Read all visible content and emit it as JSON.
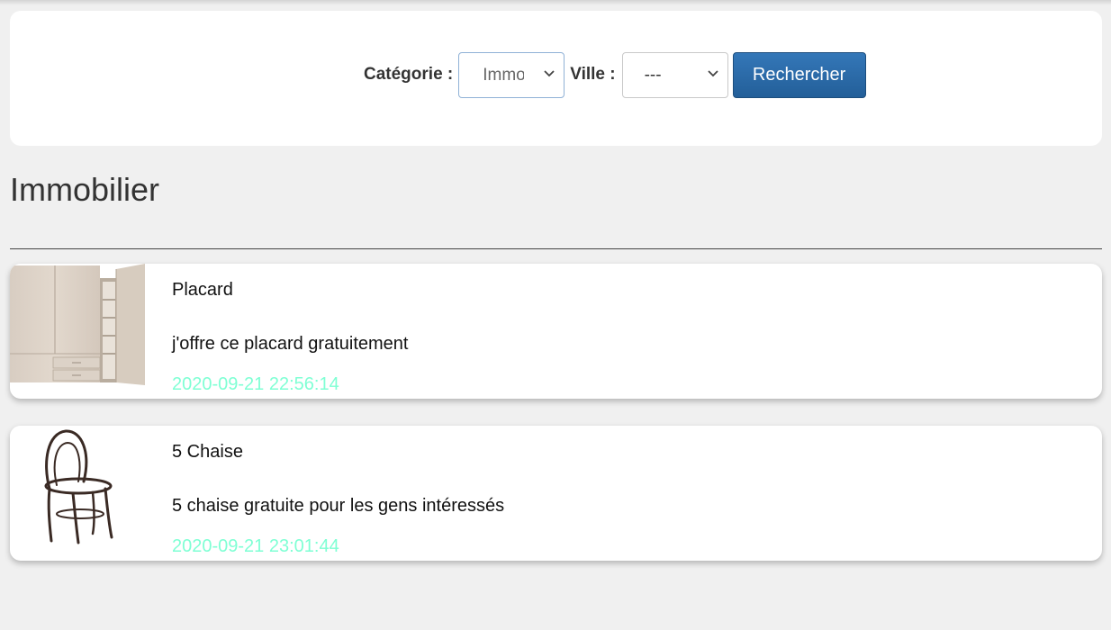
{
  "search": {
    "category_label": "Catégorie :",
    "category_value": "Immobilier",
    "city_label": "Ville :",
    "city_value": "---",
    "button_label": "Rechercher"
  },
  "page": {
    "title": "Immobilier"
  },
  "listings": [
    {
      "title": "Placard",
      "description": "j'offre ce placard gratuitement",
      "date": "2020-09-21 22:56:14",
      "image": "wardrobe"
    },
    {
      "title": "5 Chaise",
      "description": "5 chaise gratuite pour les gens intéressés",
      "date": "2020-09-21 23:01:44",
      "image": "bentwood-chair"
    }
  ],
  "colors": {
    "background": "#f0f0f0",
    "card": "#ffffff",
    "button": "#2a6aa8",
    "date": "#7fffd4"
  },
  "icons": {
    "select_arrow": "chevron-down-icon"
  }
}
